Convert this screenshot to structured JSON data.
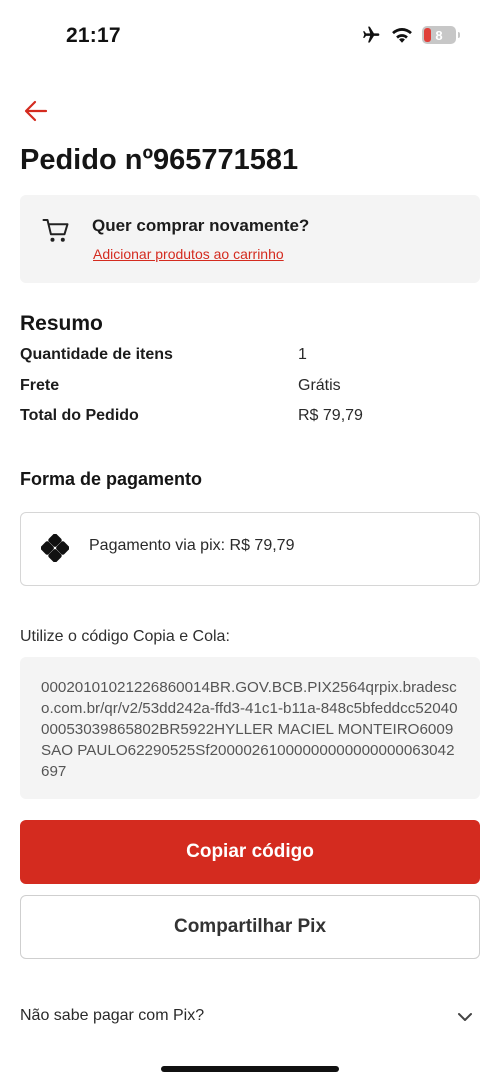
{
  "status_bar": {
    "time": "21:17",
    "battery_level": "8",
    "icons": [
      "airplane-icon",
      "wifi-icon",
      "battery-icon"
    ]
  },
  "header": {
    "back_icon": "arrow-left-icon",
    "title": "Pedido nº965771581"
  },
  "buy_again": {
    "icon": "cart-icon",
    "title": "Quer comprar novamente?",
    "link": "Adicionar produtos ao carrinho"
  },
  "summary": {
    "title": "Resumo",
    "rows": [
      {
        "label": "Quantidade de itens",
        "value": "1"
      },
      {
        "label": "Frete",
        "value": "Grátis"
      },
      {
        "label": "Total do Pedido",
        "value": "R$ 79,79"
      }
    ]
  },
  "payment": {
    "title": "Forma de pagamento",
    "icon": "pix-icon",
    "method": "Pagamento via pix: R$ 79,79"
  },
  "pix_code": {
    "instruction": "Utilize o código Copia e Cola:",
    "code": "00020101021226860014BR.GOV.BCB.PIX2564qrpix.bradesco.com.br/qr/v2/53dd242a-ffd3-41c1-b11a-848c5bfeddcc5204000053039865802BR5922HYLLER MACIEL MONTEIRO6009SAO PAULO62290525Sf20000261000000000000000063042697"
  },
  "actions": {
    "copy_label": "Copiar código",
    "share_label": "Compartilhar Pix"
  },
  "help": {
    "question": "Não sabe pagar com Pix?",
    "icon": "chevron-down-icon"
  },
  "colors": {
    "accent": "#d42b1f",
    "card_bg": "#f4f4f4",
    "text": "#1a1a1a"
  }
}
